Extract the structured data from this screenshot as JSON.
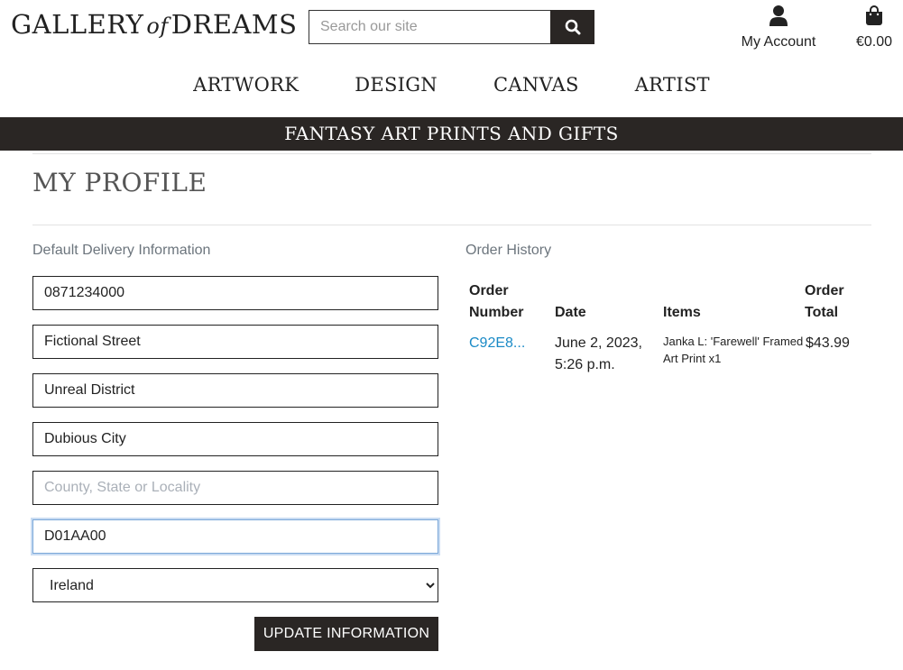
{
  "header": {
    "logo_left": "GALLERY",
    "logo_of": "of",
    "logo_right": "DREAMS",
    "search_placeholder": "Search our site",
    "account_label": "My Account",
    "cart_label": "€0.00"
  },
  "nav": {
    "items": [
      "ARTWORK",
      "DESIGN",
      "CANVAS",
      "ARTIST"
    ]
  },
  "banner": {
    "text": "FANTASY ART PRINTS AND GIFTS"
  },
  "profile": {
    "title": "MY PROFILE",
    "delivery_label": "Default Delivery Information",
    "fields": {
      "phone": "0871234000",
      "street": "Fictional Street",
      "district": "Unreal District",
      "city": "Dubious City",
      "county_placeholder": "County, State or Locality",
      "postcode": "D01AA00",
      "country": "Ireland"
    },
    "update_button": "UPDATE INFORMATION"
  },
  "orders": {
    "label": "Order History",
    "headers": {
      "number_line1": "Order",
      "number_line2": "Number",
      "date": "Date",
      "items": "Items",
      "total_line1": "Order",
      "total_line2": "Total"
    },
    "rows": [
      {
        "number": "C92E8...",
        "date_line1": "June 2, 2023,",
        "date_line2": "5:26 p.m.",
        "items_line1": "Janka L: 'Farewell' Framed",
        "items_line2": "Art Print x1",
        "total": "$43.99"
      }
    ]
  }
}
